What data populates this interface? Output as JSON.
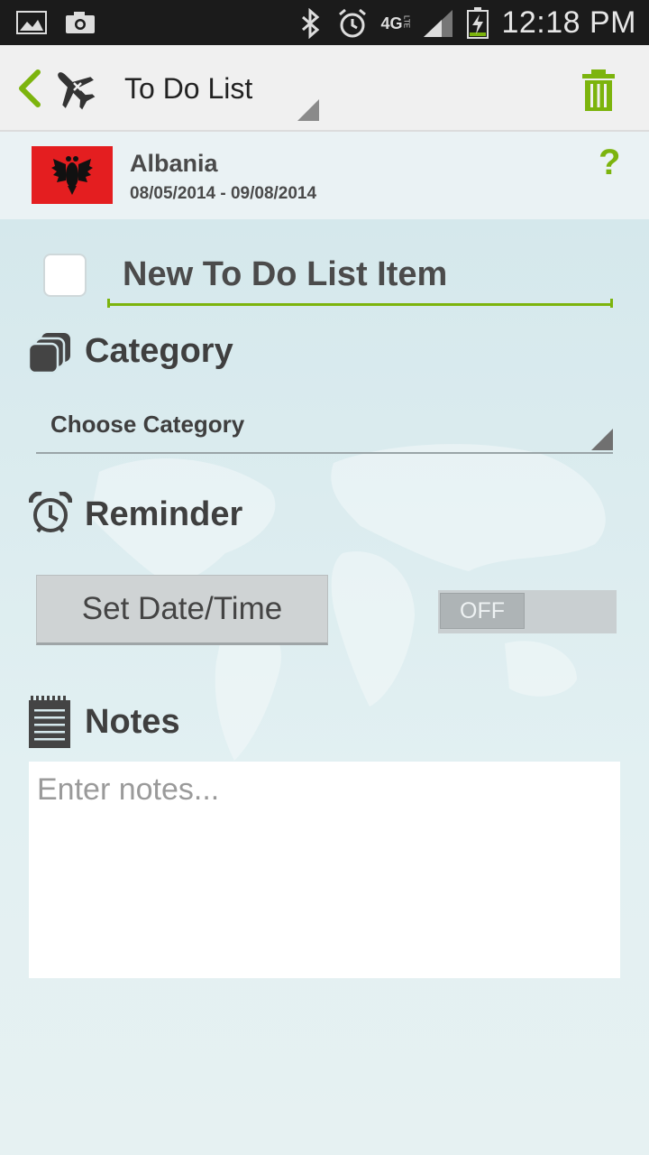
{
  "status_bar": {
    "time": "12:18 PM",
    "network": "4G",
    "network_sub": "LTE",
    "icons": [
      "gallery-icon",
      "camera-icon",
      "bluetooth-icon",
      "alarm-icon",
      "network-4g-icon",
      "signal-icon",
      "battery-charging-icon"
    ]
  },
  "action_bar": {
    "title": "To Do List",
    "icons": [
      "back-icon",
      "plane-icon",
      "trash-icon"
    ]
  },
  "trip": {
    "name": "Albania",
    "dates": "08/05/2014 - 09/08/2014",
    "help": "?"
  },
  "item": {
    "placeholder": "New To Do List Item",
    "checked": false
  },
  "category": {
    "label": "Category",
    "selected": "Choose Category"
  },
  "reminder": {
    "label": "Reminder",
    "set_button": "Set Date/Time",
    "toggle": "OFF"
  },
  "notes": {
    "label": "Notes",
    "placeholder": "Enter notes..."
  },
  "colors": {
    "accent": "#7cb40d",
    "status_bar": "#1b1b1b",
    "flag_red": "#e41e20"
  }
}
